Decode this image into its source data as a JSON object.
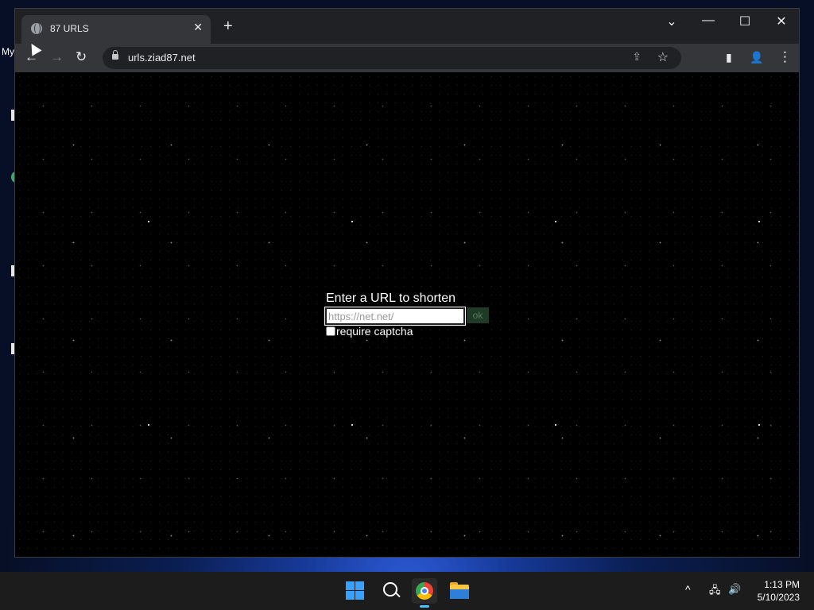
{
  "desktop": {
    "partial_label": "My"
  },
  "browser": {
    "tab": {
      "title": "87 URLS",
      "close": "✕"
    },
    "new_tab": "+",
    "window_controls": {
      "dropdown": "⌄",
      "minimize": "—",
      "maximize": "☐",
      "close": "✕"
    },
    "toolbar": {
      "back": "←",
      "forward": "→",
      "reload": "↻",
      "address": "urls.ziad87.net",
      "share": "⇪",
      "bookmark": "☆",
      "side_panel": "▮",
      "profile": "👤",
      "menu": "⋮"
    }
  },
  "page": {
    "heading": "Enter a URL to shorten",
    "url_input": {
      "value": "",
      "placeholder": "https://net.net/"
    },
    "ok_button": "ok",
    "captcha_label": "require captcha",
    "captcha_checked": false,
    "background": "starfield"
  },
  "taskbar": {
    "items": [
      "start-icon",
      "search-icon",
      "chrome-icon",
      "file-explorer-icon"
    ],
    "tray": {
      "chevron": "^",
      "network": "🖧",
      "volume": "🔊"
    },
    "clock": {
      "time": "1:13 PM",
      "date": "5/10/2023"
    }
  },
  "colors": {
    "accent_windows": "#3aa0ff",
    "browser_bg": "#202124",
    "toolbar_bg": "#35363a",
    "ok_button_bg": "#1f3a26"
  }
}
